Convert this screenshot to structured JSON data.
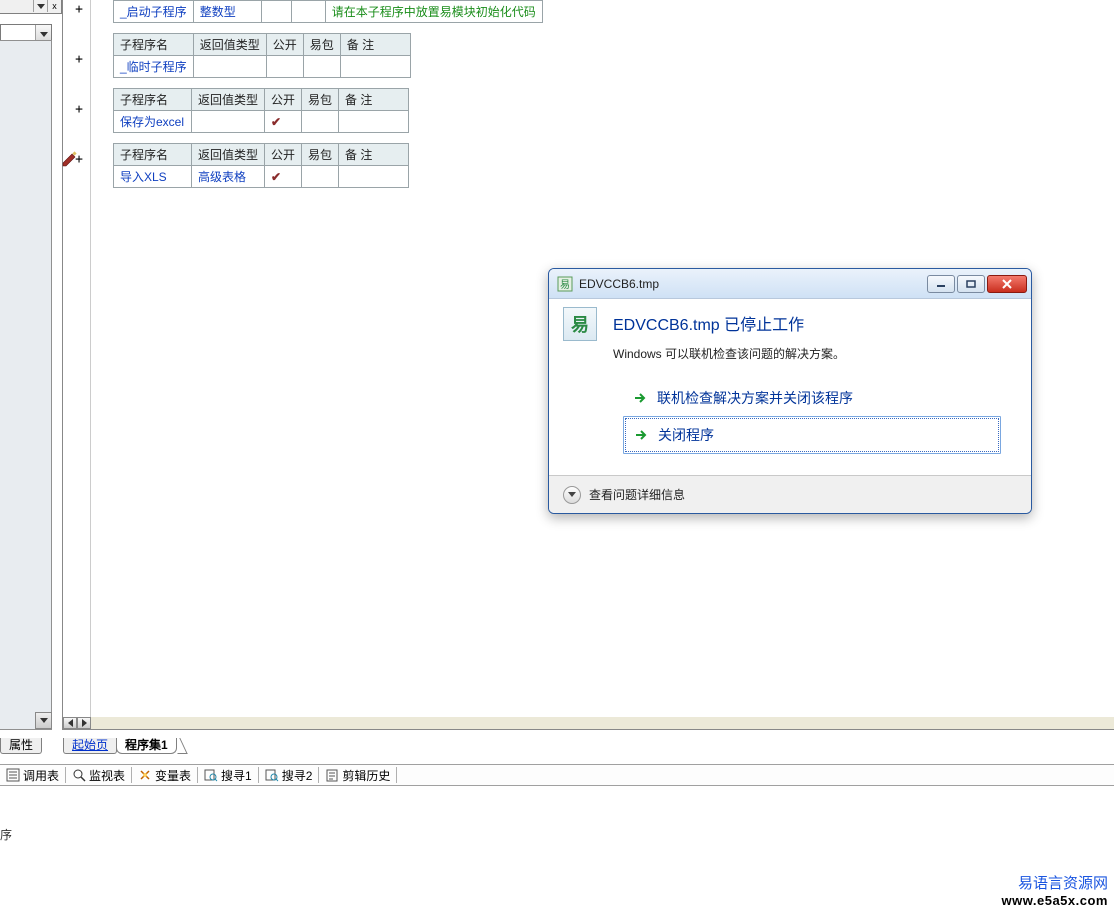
{
  "top_panel": {
    "close_x": "x"
  },
  "tables": {
    "headers": {
      "name": "子程序名",
      "ret": "返回值类型",
      "pub": "公开",
      "pkg": "易包",
      "note": "备 注"
    },
    "row0": {
      "name": "_启动子程序",
      "ret": "整数型",
      "note": "请在本子程序中放置易模块初始化代码"
    },
    "row1": {
      "name": "_临时子程序"
    },
    "row2": {
      "name": "保存为excel",
      "pub_check": "✔"
    },
    "row3": {
      "name": "导入XLS",
      "ret": "高级表格",
      "pub_check": "✔"
    }
  },
  "tabs": {
    "prop": "属性",
    "start": "起始页",
    "progset": "程序集1"
  },
  "status_items": {
    "calltable": "调用表",
    "watch": "监视表",
    "vartable": "变量表",
    "search1": "搜寻1",
    "search2": "搜寻2",
    "cliphist": "剪辑历史"
  },
  "status_line": "序",
  "dialog": {
    "title": "EDVCCB6.tmp",
    "heading": "EDVCCB6.tmp 已停止工作",
    "sub": "Windows 可以联机检查该问题的解决方案。",
    "option1": "联机检查解决方案并关闭该程序",
    "option2": "关闭程序",
    "footer": "查看问题详细信息",
    "icon_glyph": "易"
  },
  "watermark": {
    "cn": "易语言资源网",
    "en": "www.e5a5x.com"
  }
}
